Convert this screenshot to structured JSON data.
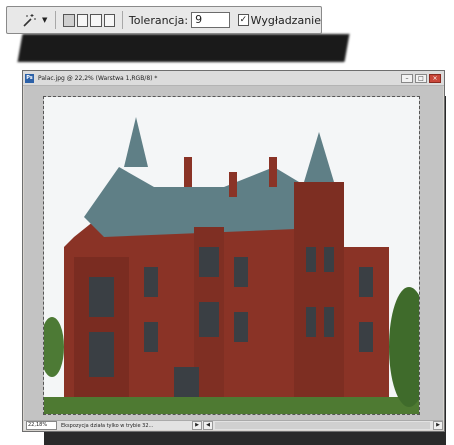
{
  "toolbar": {
    "tool_icon": "magic-wand-icon",
    "tolerance_label": "Tolerancja:",
    "tolerance_value": "9",
    "antialias_label": "Wygładzanie",
    "antialias_checked": true
  },
  "window": {
    "title": "Palac.jpg @ 22,2% (Warstwa 1,RGB/8) *",
    "app_icon_text": "Ps",
    "minimize": "–",
    "maximize": "□",
    "close": "×"
  },
  "statusbar": {
    "zoom": "22,18%",
    "info": "Ekspozycja działa tylko w trybie 32..."
  },
  "colors": {
    "brick": "#8a3326",
    "roof": "#5f7f86",
    "sky": "#f4f6f7",
    "grass": "#4e7a32"
  }
}
